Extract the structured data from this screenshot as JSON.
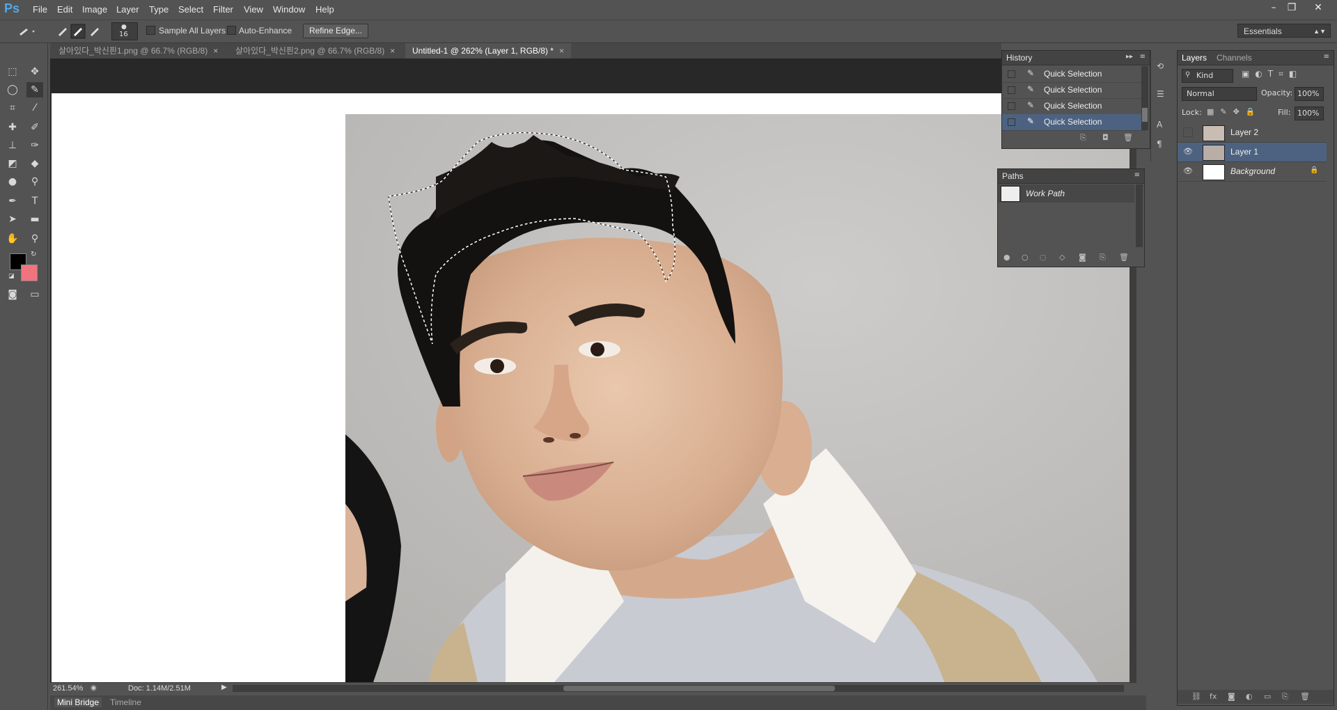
{
  "app": {
    "logo": "Ps"
  },
  "menu": [
    "File",
    "Edit",
    "Image",
    "Layer",
    "Type",
    "Select",
    "Filter",
    "View",
    "Window",
    "Help"
  ],
  "window_controls": [
    "–",
    "❐",
    "✕"
  ],
  "options": {
    "brush_size": "16",
    "sample_all_layers": "Sample All Layers",
    "auto_enhance": "Auto-Enhance",
    "refine_edge": "Refine Edge...",
    "workspace": "Essentials"
  },
  "tabs": [
    {
      "label": "살아있다_박신픤1.png @ 66.7% (RGB/8)"
    },
    {
      "label": "살아있다_박신픤2.png @ 66.7% (RGB/8)"
    },
    {
      "label": "Untitled-1 @ 262% (Layer 1, RGB/8) *"
    }
  ],
  "tab_close": "×",
  "status": {
    "zoom": "261.54%",
    "doc": "Doc: 1.14M/2.51M"
  },
  "bottom_tabs": [
    "Mini Bridge",
    "Timeline"
  ],
  "history": {
    "title": "History",
    "items": [
      "Quick Selection",
      "Quick Selection",
      "Quick Selection",
      "Quick Selection"
    ]
  },
  "paths": {
    "title": "Paths",
    "items": [
      "Work Path"
    ]
  },
  "layers": {
    "tabs": [
      "Layers",
      "Channels"
    ],
    "filter": "Kind",
    "blend_mode": "Normal",
    "opacity_label": "Opacity:",
    "opacity": "100%",
    "lock_label": "Lock:",
    "fill_label": "Fill:",
    "fill": "100%",
    "items": [
      {
        "name": "Layer 2",
        "visible": false
      },
      {
        "name": "Layer 1",
        "visible": true
      },
      {
        "name": "Background",
        "visible": true
      }
    ]
  },
  "colors": {
    "foreground": "#000000",
    "background": "#f0747e",
    "selection": "#4c6280"
  }
}
